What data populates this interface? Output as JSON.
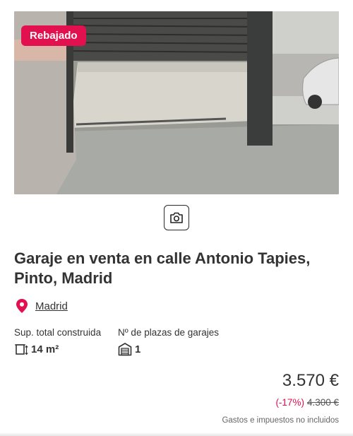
{
  "listing": {
    "badge": "Rebajado",
    "title": "Garaje en venta en calle Antonio Tapies, Pinto, Madrid",
    "location": "Madrid",
    "features": [
      {
        "label": "Sup. total construida",
        "value": "14 m²",
        "icon": "area-icon"
      },
      {
        "label": "Nº de plazas de garajes",
        "value": "1",
        "icon": "garage-icon"
      }
    ],
    "price": "3.570 €",
    "discount": "(-17%)",
    "old_price": "4.300 €",
    "tax_note": "Gastos e impuestos no incluidos"
  },
  "colors": {
    "accent": "#e2104f",
    "text": "#333333"
  }
}
